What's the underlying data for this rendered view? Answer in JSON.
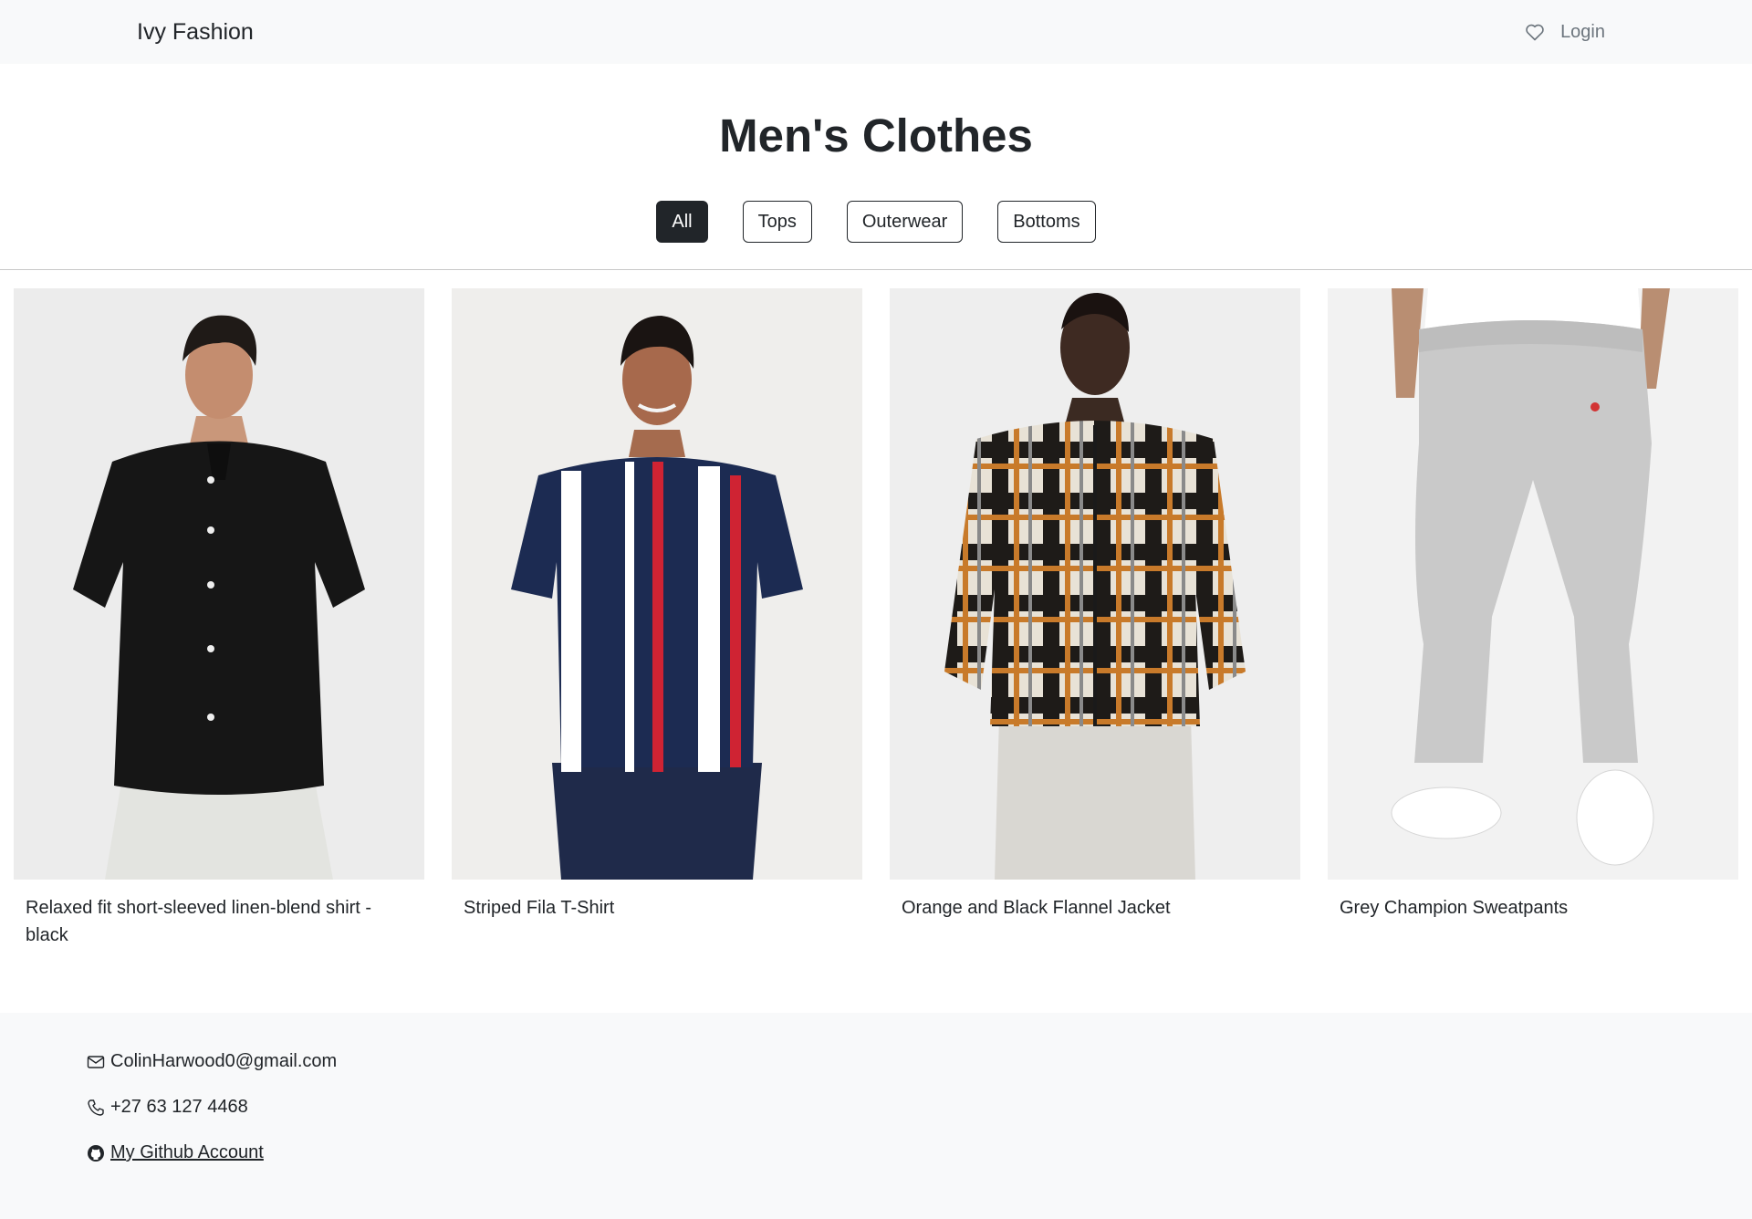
{
  "header": {
    "brand": "Ivy Fashion",
    "login_label": "Login"
  },
  "main": {
    "title": "Men's Clothes",
    "filters": [
      {
        "label": "All",
        "active": true
      },
      {
        "label": "Tops",
        "active": false
      },
      {
        "label": "Outerwear",
        "active": false
      },
      {
        "label": "Bottoms",
        "active": false
      }
    ],
    "products": [
      {
        "name": "Relaxed fit short-sleeved linen-blend shirt - black"
      },
      {
        "name": "Striped Fila T-Shirt"
      },
      {
        "name": "Orange and Black Flannel Jacket"
      },
      {
        "name": "Grey Champion Sweatpants"
      }
    ]
  },
  "footer": {
    "email": "ColinHarwood0@gmail.com",
    "phone": "+27 63 127 4468",
    "github_label": "My Github Account"
  },
  "icons": {
    "wishlist": "heart-icon",
    "email": "envelope-icon",
    "phone": "phone-icon",
    "github": "github-icon"
  },
  "colors": {
    "dark": "#212529",
    "navbar_bg": "#f8f9fa",
    "muted": "#6c757d"
  }
}
